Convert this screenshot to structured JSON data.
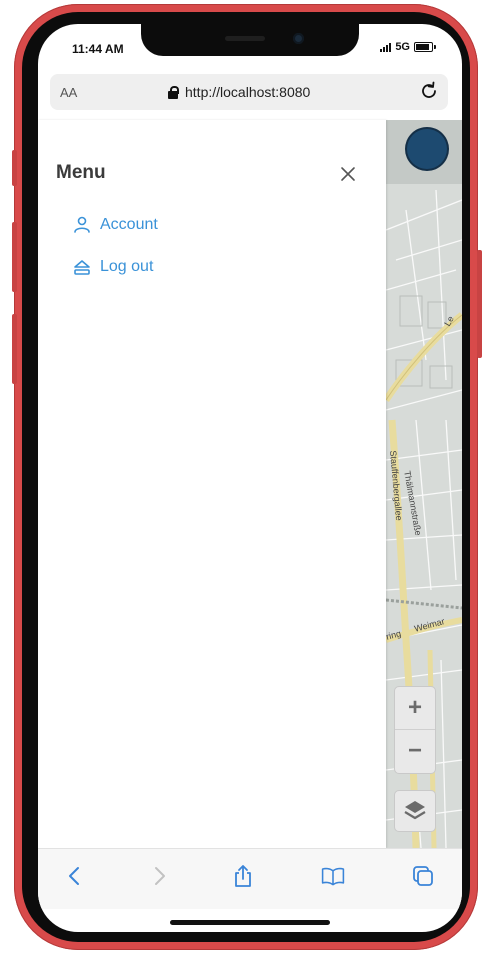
{
  "status_bar": {
    "time": "11:44 AM",
    "network": "5G"
  },
  "browser": {
    "text_size_label": "AA",
    "url": "http://localhost:8080"
  },
  "menu": {
    "title": "Menu",
    "items": [
      {
        "label": "Account",
        "icon": "user-icon"
      },
      {
        "label": "Log out",
        "icon": "logout-icon"
      }
    ]
  },
  "map": {
    "street_labels": [
      "Thälmannstraße",
      "Stauffenbergallee",
      "Weimar",
      "ring",
      "Le"
    ],
    "zoom_in_label": "+",
    "zoom_out_label": "−"
  },
  "toolbar": {
    "icons": [
      "back-icon",
      "forward-icon",
      "share-icon",
      "bookmarks-icon",
      "tabs-icon"
    ]
  },
  "colors": {
    "link": "#3a92d8",
    "phone_frame": "#d84a4a",
    "map_road": "#e8dc9e"
  }
}
